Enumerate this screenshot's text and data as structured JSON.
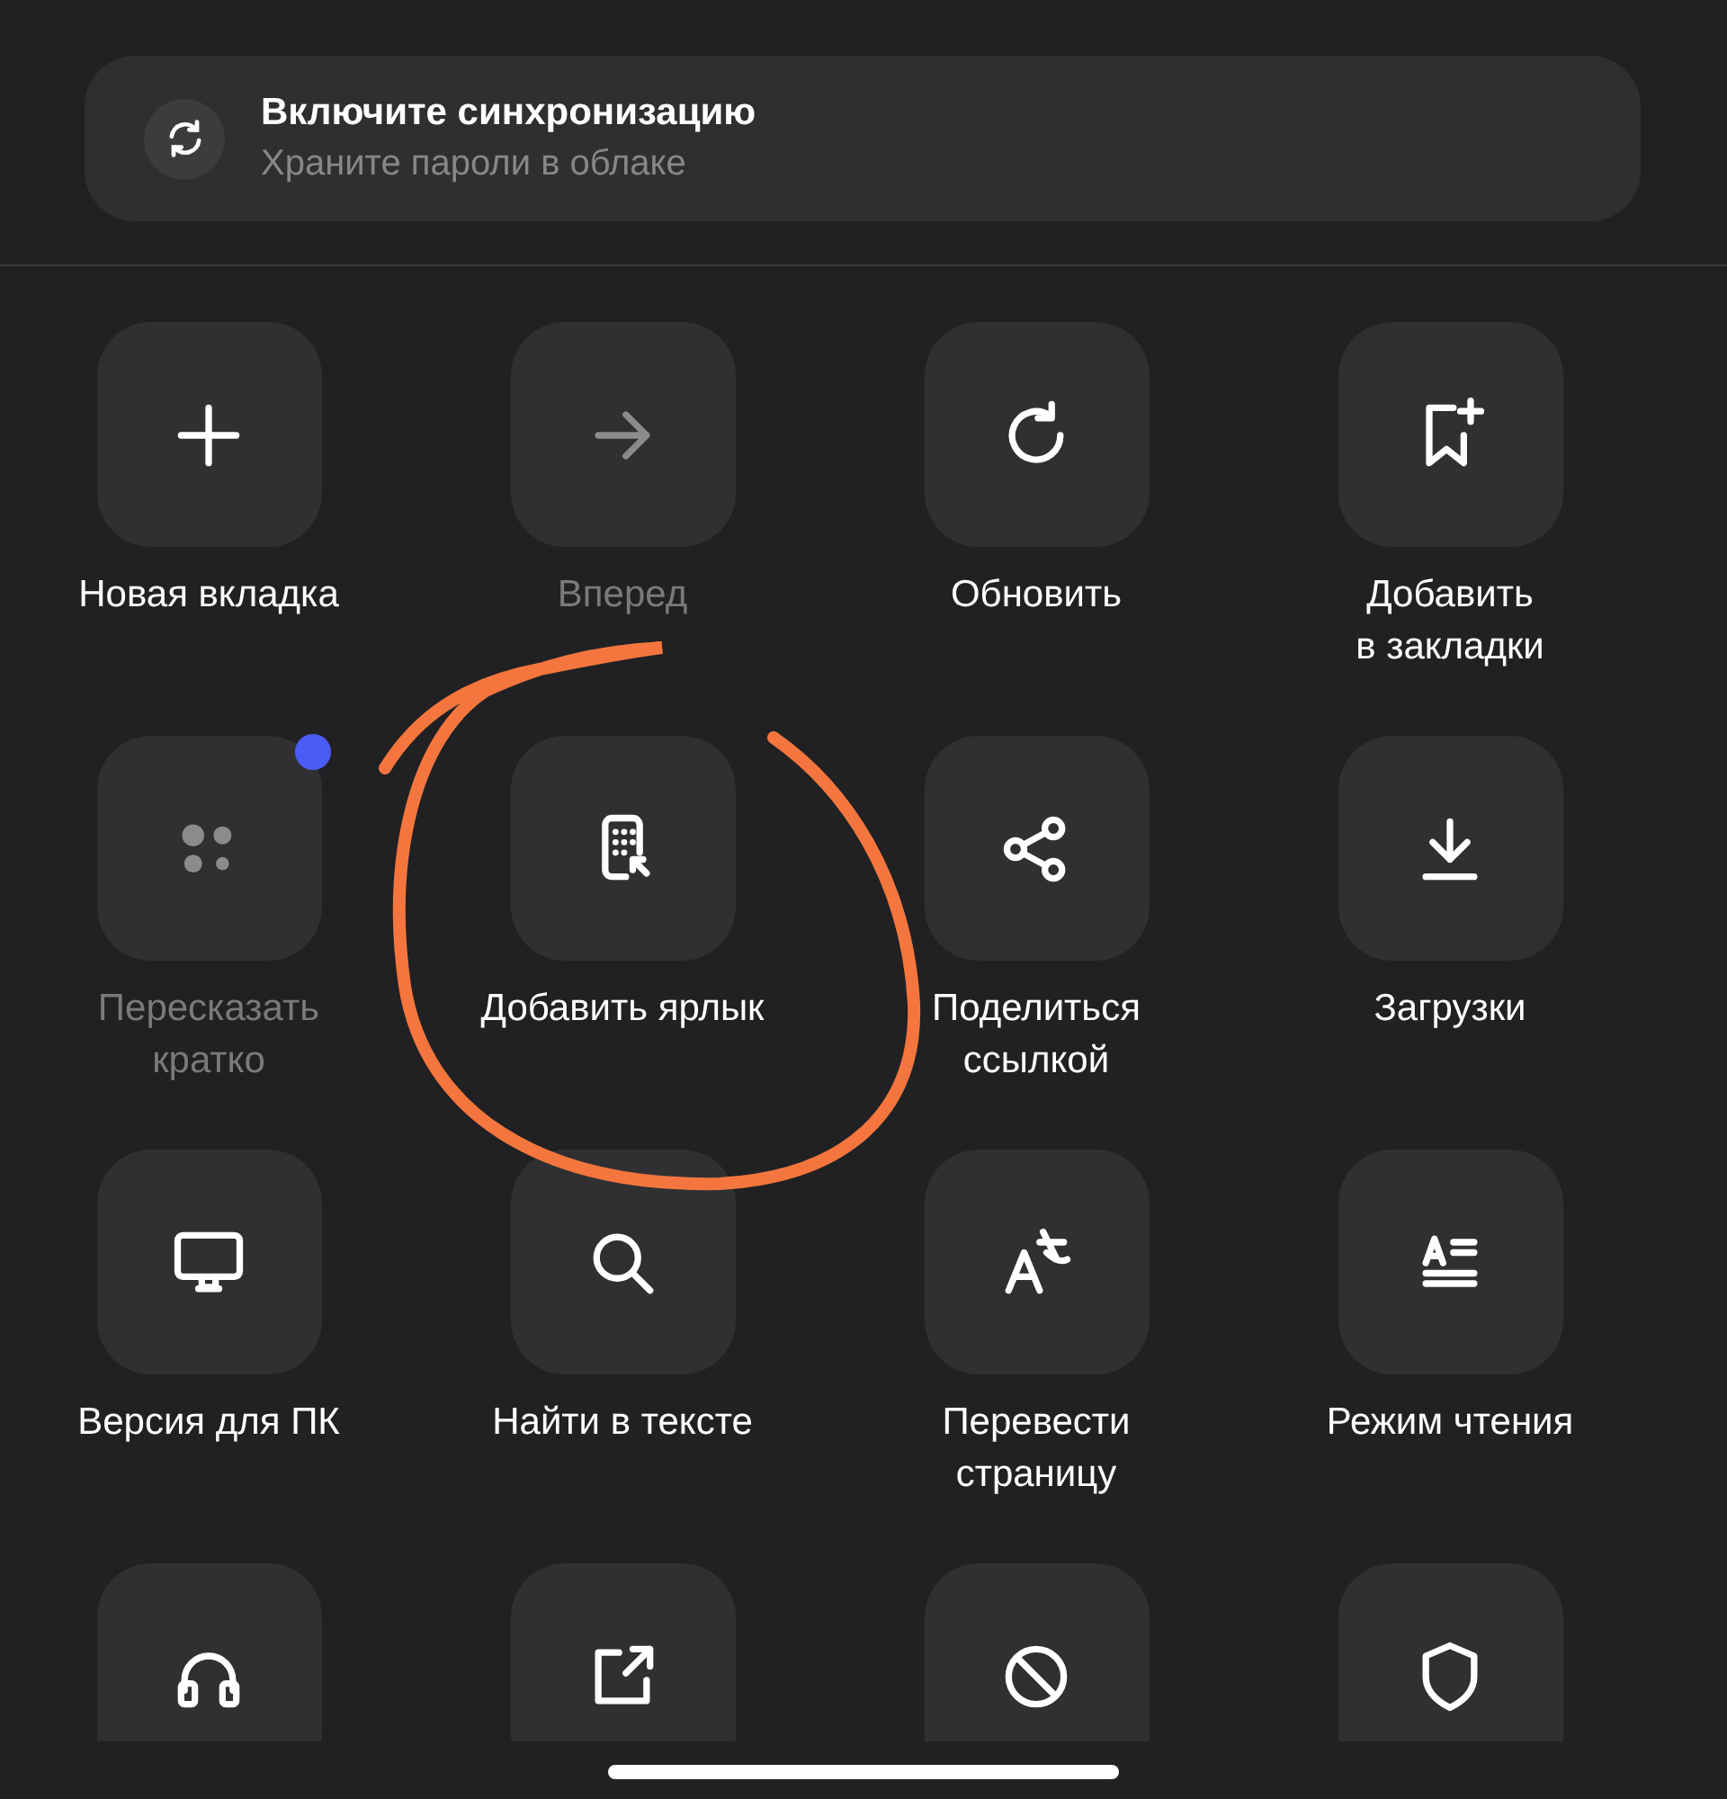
{
  "sync_card": {
    "title": "Включите синхронизацию",
    "subtitle": "Храните пароли в облаке"
  },
  "actions": [
    {
      "label": "Новая вкладка",
      "disabled": false,
      "badge": false
    },
    {
      "label": "Вперед",
      "disabled": true,
      "badge": false
    },
    {
      "label": "Обновить",
      "disabled": false,
      "badge": false
    },
    {
      "label": "Добавить\nв закладки",
      "disabled": false,
      "badge": false
    },
    {
      "label": "Пересказать\nкратко",
      "disabled": true,
      "badge": true
    },
    {
      "label": "Добавить ярлык",
      "disabled": false,
      "badge": false
    },
    {
      "label": "Поделиться\nссылкой",
      "disabled": false,
      "badge": false
    },
    {
      "label": "Загрузки",
      "disabled": false,
      "badge": false
    },
    {
      "label": "Версия для ПК",
      "disabled": false,
      "badge": false
    },
    {
      "label": "Найти в тексте",
      "disabled": false,
      "badge": false
    },
    {
      "label": "Перевести\nстраницу",
      "disabled": false,
      "badge": false
    },
    {
      "label": "Режим чтения",
      "disabled": false,
      "badge": false
    },
    {
      "disabled": false,
      "badge": false
    },
    {
      "disabled": false,
      "badge": false
    },
    {
      "disabled": false,
      "badge": false
    },
    {
      "disabled": false,
      "badge": false
    }
  ],
  "annotation": {
    "kind": "circle"
  }
}
